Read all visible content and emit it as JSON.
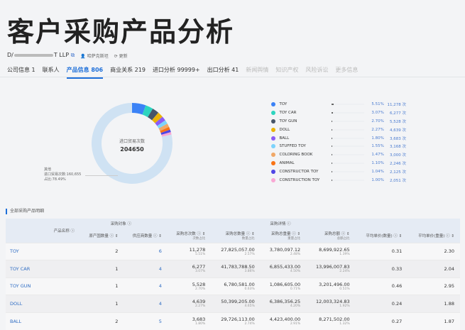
{
  "title": "客户采购产品分析",
  "company": {
    "name_start": "D/",
    "name_end": "T LLP",
    "contact": "哈萨克斯坦",
    "refresh": "更新"
  },
  "tabs": [
    {
      "label": "公司信息 1"
    },
    {
      "label": "联系人"
    },
    {
      "label": "产品信息 806",
      "active": true
    },
    {
      "label": "商业关系 219"
    },
    {
      "label": "进口分析 99999+"
    },
    {
      "label": "出口分析 41"
    },
    {
      "label": "新闻舆情",
      "disabled": true
    },
    {
      "label": "知识产权",
      "disabled": true
    },
    {
      "label": "风险诉讼",
      "disabled": true
    },
    {
      "label": "更多信息",
      "disabled": true
    }
  ],
  "donut": {
    "center_label": "进口贸易次数",
    "center_value": "204650",
    "other_title": "其他",
    "other_count": "进口贸易次数:160,655",
    "other_pct": "占比:78.49%",
    "other_color": "#cfe2f3"
  },
  "legend": [
    {
      "name": "TOY",
      "pct": "5.51%",
      "count": "11,278 次",
      "value": 5.51,
      "color": "#3b82f6"
    },
    {
      "name": "TOY CAR",
      "pct": "3.07%",
      "count": "6,277 次",
      "value": 3.07,
      "color": "#2dd4bf"
    },
    {
      "name": "TOY GUN",
      "pct": "2.70%",
      "count": "5,528 次",
      "value": 2.7,
      "color": "#475569"
    },
    {
      "name": "DOLL",
      "pct": "2.27%",
      "count": "4,639 次",
      "value": 2.27,
      "color": "#eab308"
    },
    {
      "name": "BALL",
      "pct": "1.80%",
      "count": "3,683 次",
      "value": 1.8,
      "color": "#8b5cf6"
    },
    {
      "name": "STUFFED TOY",
      "pct": "1.55%",
      "count": "3,168 次",
      "value": 1.55,
      "color": "#7dd3fc"
    },
    {
      "name": "COLORING BOOK",
      "pct": "1.47%",
      "count": "3,000 次",
      "value": 1.47,
      "color": "#f0a868"
    },
    {
      "name": "ANIMAL",
      "pct": "1.10%",
      "count": "2,246 次",
      "value": 1.1,
      "color": "#f97316"
    },
    {
      "name": "CONSTRUCTOR TOY",
      "pct": "1.04%",
      "count": "2,125 次",
      "value": 1.04,
      "color": "#4f46e5"
    },
    {
      "name": "CONSTRUCTION TOY",
      "pct": "1.00%",
      "count": "2,051 次",
      "value": 1.0,
      "color": "#f9a8d4"
    }
  ],
  "table": {
    "section_title": "全部采购产品明细",
    "group1": "采购对象",
    "group2": "采购详情",
    "headers": {
      "name": "产品名称",
      "countries": "原产国数量",
      "suppliers": "供应商数量",
      "times": "采购总次数",
      "times_sub": "次数占比",
      "qty": "采购总数量",
      "qty_sub": "数量占比",
      "weight": "采购总重量",
      "weight_sub": "重量占比",
      "amount": "采购总额",
      "amount_sub": "总额占比",
      "avg_qty": "平均单价(数量)",
      "avg_weight": "平均单价(重量)"
    },
    "rows": [
      {
        "name": "TOY",
        "countries": "2",
        "suppliers": "6",
        "times": "11,278",
        "times_pct": "5.51%",
        "qty": "27,825,057.00",
        "qty_pct": "2.57%",
        "weight": "3,780,097.12",
        "weight_pct": "2.48%",
        "amount": "8,699,922.65",
        "amount_pct": "1.39%",
        "avg_qty": "0.31",
        "avg_weight": "2.30"
      },
      {
        "name": "TOY CAR",
        "countries": "1",
        "suppliers": "4",
        "times": "6,277",
        "times_pct": "3.07%",
        "qty": "41,783,788.50",
        "qty_pct": "3.86%",
        "weight": "6,855,433.00",
        "weight_pct": "4.50%",
        "amount": "13,996,007.83",
        "amount_pct": "2.24%",
        "avg_qty": "0.33",
        "avg_weight": "2.04"
      },
      {
        "name": "TOY GUN",
        "countries": "1",
        "suppliers": "4",
        "times": "5,528",
        "times_pct": "2.70%",
        "qty": "6,780,581.00",
        "qty_pct": "0.63%",
        "weight": "1,086,605.00",
        "weight_pct": "0.71%",
        "amount": "3,201,496.00",
        "amount_pct": "0.51%",
        "avg_qty": "0.46",
        "avg_weight": "2.95"
      },
      {
        "name": "DOLL",
        "countries": "1",
        "suppliers": "4",
        "times": "4,639",
        "times_pct": "2.27%",
        "qty": "50,399,205.00",
        "qty_pct": "4.65%",
        "weight": "6,386,356.25",
        "weight_pct": "4.20%",
        "amount": "12,003,324.83",
        "amount_pct": "1.92%",
        "avg_qty": "0.24",
        "avg_weight": "1.88"
      },
      {
        "name": "BALL",
        "countries": "2",
        "suppliers": "5",
        "times": "3,683",
        "times_pct": "1.80%",
        "qty": "29,726,113.00",
        "qty_pct": "2.74%",
        "weight": "4,423,400.00",
        "weight_pct": "2.91%",
        "amount": "8,271,502.00",
        "amount_pct": "1.32%",
        "avg_qty": "0.27",
        "avg_weight": "1.87"
      }
    ]
  }
}
